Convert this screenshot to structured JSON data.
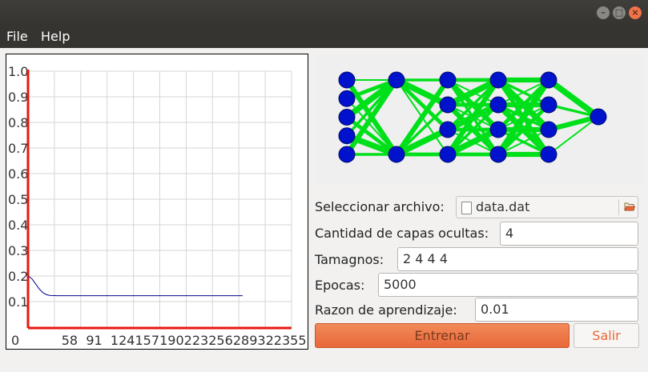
{
  "window": {
    "min_glyph": "–",
    "max_glyph": "□",
    "close_glyph": "×"
  },
  "menu": {
    "file": "File",
    "help": "Help"
  },
  "chart_data": {
    "type": "line",
    "y_ticks": [
      "1.0",
      "0.9",
      "0.8",
      "0.7",
      "0.6",
      "0.5",
      "0.4",
      "0.3",
      "0.2",
      "0.1"
    ],
    "x_ticks": [
      "0",
      "58",
      "91",
      "124",
      "157",
      "190",
      "223",
      "256",
      "289",
      "322",
      "355"
    ],
    "ylim": [
      0,
      1.0
    ],
    "xlim": [
      0,
      355
    ],
    "grid": true,
    "series": [
      {
        "color": "#00008b",
        "x": [
          0,
          5,
          10,
          15,
          20,
          25,
          30,
          40,
          60,
          100,
          150,
          200,
          250,
          289
        ],
        "y": [
          0.2,
          0.19,
          0.17,
          0.15,
          0.135,
          0.127,
          0.124,
          0.123,
          0.123,
          0.123,
          0.123,
          0.123,
          0.123,
          0.123
        ]
      }
    ],
    "axis_color": "#e8170f"
  },
  "network": {
    "layers": [
      5,
      2,
      4,
      4,
      4,
      1
    ],
    "node_color": "#0012cc",
    "edge_color": "#00e01a"
  },
  "form": {
    "file_label": "Seleccionar archivo:",
    "file_value": "data.dat",
    "hidden_layers_label": "Cantidad de capas ocultas:",
    "hidden_layers_value": "4",
    "sizes_label": "Tamagnos:",
    "sizes_value": "2 4 4 4",
    "epochs_label": "Epocas:",
    "epochs_value": "5000",
    "lr_label": "Razon de aprendizaje:",
    "lr_value": "0.01"
  },
  "buttons": {
    "train": "Entrenar",
    "exit": "Salir"
  }
}
